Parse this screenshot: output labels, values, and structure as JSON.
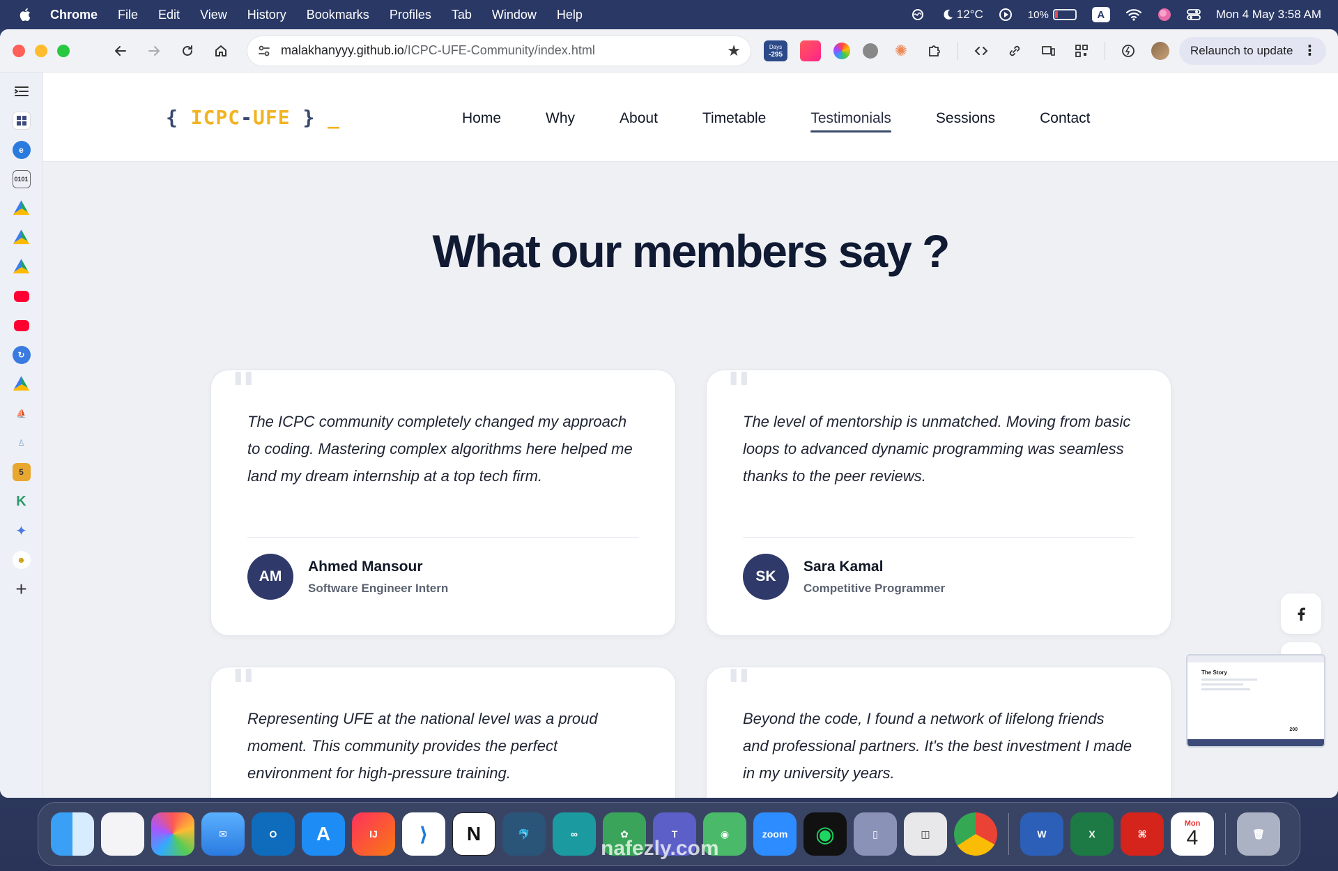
{
  "menubar": {
    "app": "Chrome",
    "items": [
      "File",
      "Edit",
      "View",
      "History",
      "Bookmarks",
      "Profiles",
      "Tab",
      "Window",
      "Help"
    ],
    "weather": "12°C",
    "battery": "10%",
    "input_source": "A",
    "clock": "Mon 4 May  3:58 AM"
  },
  "browser": {
    "url_host": "malakhanyyy.github.io",
    "url_path": "/ICPC-UFE-Community/index.html",
    "days_badge_top": "Days",
    "days_badge_value": "-295",
    "relaunch_label": "Relaunch to update"
  },
  "site": {
    "logo": {
      "open": "{",
      "part1": "ICPC",
      "dash": "-",
      "part2": "UFE",
      "close": "}",
      "cursor": "_"
    },
    "nav": [
      {
        "label": "Home"
      },
      {
        "label": "Why"
      },
      {
        "label": "About"
      },
      {
        "label": "Timetable"
      },
      {
        "label": "Testimonials"
      },
      {
        "label": "Sessions"
      },
      {
        "label": "Contact"
      }
    ],
    "section_title": "What our members say ?",
    "testimonials": [
      {
        "text": "The ICPC community completely changed my approach to coding. Mastering complex algorithms here helped me land my dream internship at a top tech firm.",
        "initials": "AM",
        "name": "Ahmed Mansour",
        "role": "Software Engineer Intern"
      },
      {
        "text": "The level of mentorship is unmatched. Moving from basic loops to advanced dynamic programming was seamless thanks to the peer reviews.",
        "initials": "SK",
        "name": "Sara Kamal",
        "role": "Competitive Programmer"
      },
      {
        "text": "Representing UFE at the national level was a proud moment. This community provides the perfect environment for high-pressure training."
      },
      {
        "text": "Beyond the code, I found a network of lifelong friends and professional partners. It's the best investment I made in my university years."
      }
    ]
  },
  "preview": {
    "title": "The Story",
    "number": "200"
  },
  "dock": {
    "zoom_label": "zoom",
    "calendar_month": "Mon",
    "calendar_day": "4",
    "watermark": "nafezly.com"
  }
}
